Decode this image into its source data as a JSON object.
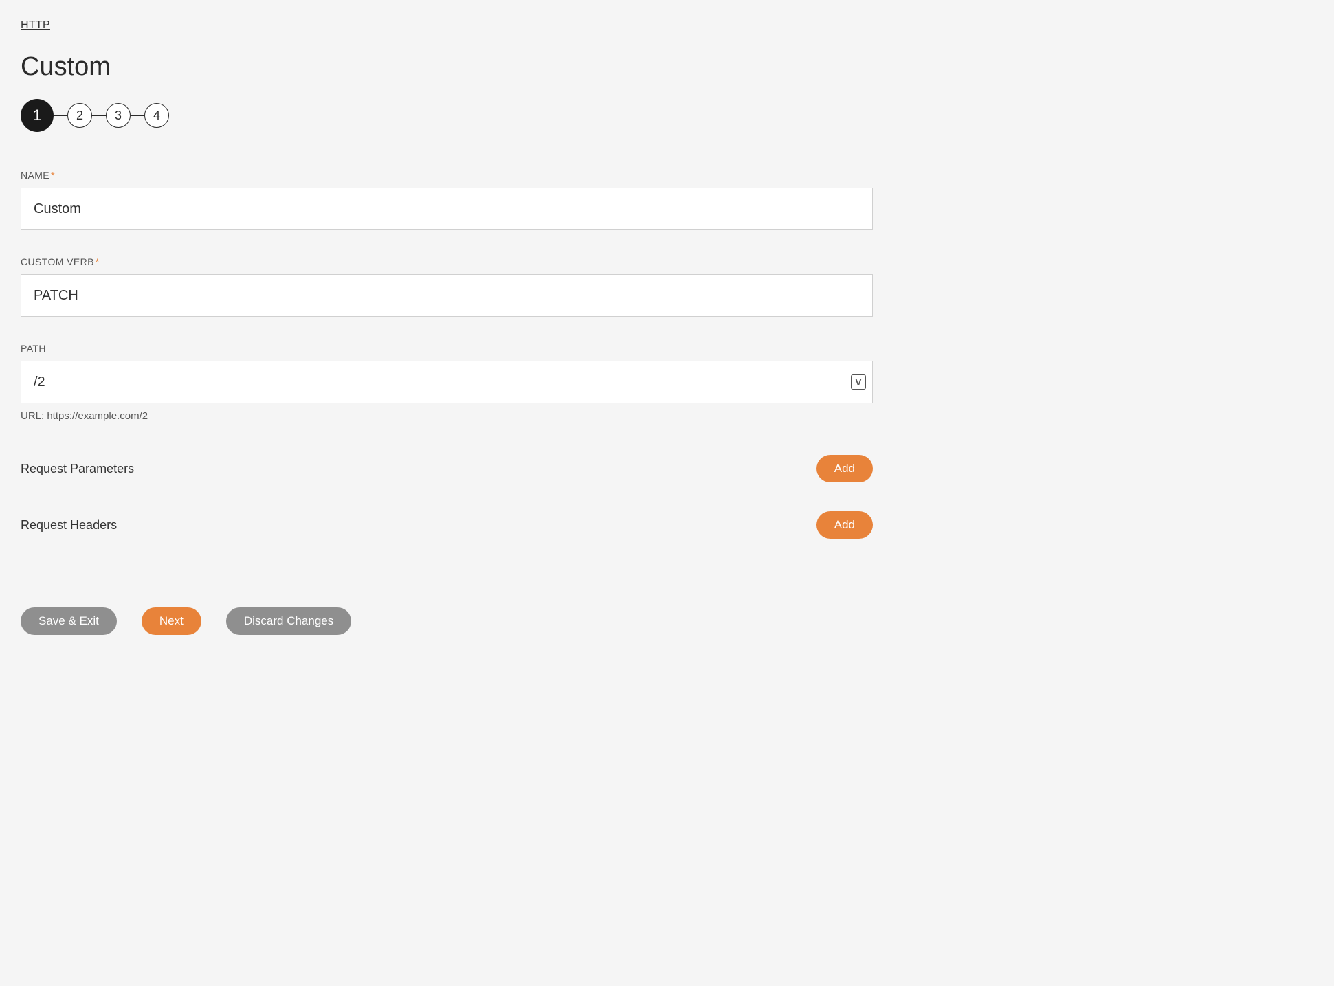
{
  "breadcrumb": "HTTP",
  "page_title": "Custom",
  "stepper": {
    "steps": [
      "1",
      "2",
      "3",
      "4"
    ],
    "active_index": 0
  },
  "fields": {
    "name": {
      "label": "NAME",
      "required_mark": "*",
      "value": "Custom"
    },
    "custom_verb": {
      "label": "CUSTOM VERB",
      "required_mark": "*",
      "value": "PATCH"
    },
    "path": {
      "label": "PATH",
      "value": "/2",
      "url_hint": "URL: https://example.com/2",
      "var_icon_label": "V"
    }
  },
  "sections": {
    "request_parameters": {
      "title": "Request Parameters",
      "add_label": "Add"
    },
    "request_headers": {
      "title": "Request Headers",
      "add_label": "Add"
    }
  },
  "footer": {
    "save_exit": "Save & Exit",
    "next": "Next",
    "discard": "Discard Changes"
  }
}
